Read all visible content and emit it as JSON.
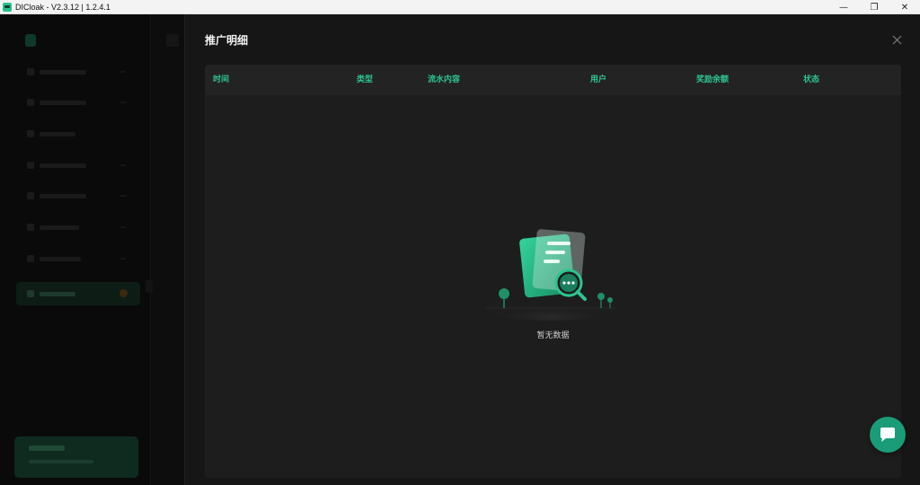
{
  "window": {
    "title": "DICloak - V2.3.12 | 1.2.4.1",
    "controls": {
      "minimize": "—",
      "restore": "❐",
      "close": "✕"
    }
  },
  "drawer": {
    "title": "推广明细",
    "close_icon": "close-icon"
  },
  "table": {
    "columns": [
      "时间",
      "类型",
      "流水内容",
      "用户",
      "奖励余额",
      "状态"
    ],
    "rows": [],
    "empty_text": "暂无数据"
  },
  "colors": {
    "accent": "#2ec48f",
    "panel_bg": "#161616",
    "card_bg": "#1d1d1d",
    "header_bg": "#232323",
    "chat_button": "#1a9c78"
  },
  "icons": {
    "app": "dicloak-logo-icon",
    "empty": "empty-document-search-icon",
    "chat": "chat-bubble-icon"
  }
}
